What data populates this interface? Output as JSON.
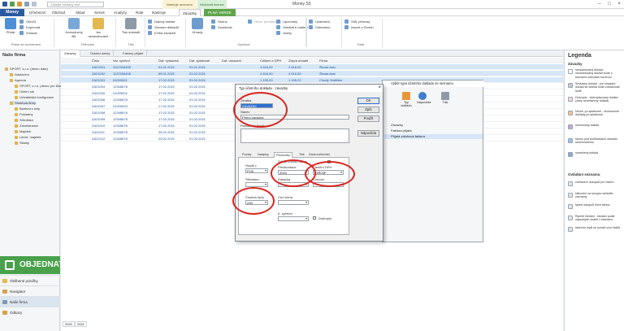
{
  "app": {
    "window_title": "Money S5",
    "search_placeholder": "Zadejte hledaný text",
    "context_tab_1": "Nástroje seznamu",
    "context_tab_2": "Možnosti licence"
  },
  "menu": {
    "brand": "Money",
    "tabs": [
      "Účetnictví",
      "Obchod",
      "Sklad",
      "Servis",
      "Analýzy",
      "Role",
      "Nástroje",
      "Závazky",
      "PLNÁ VERZE"
    ],
    "active_tab": "Závazky"
  },
  "ribbon": {
    "groups": [
      {
        "label": "Práce se seznamem",
        "buttons": [
          "Otevřít",
          "Kopírovat",
          "Smazat",
          "Přidat"
        ]
      },
      {
        "label": "Filtrování",
        "buttons": [
          "Jednoduchý filtr",
          "Jen nezaúčtované"
        ]
      },
      {
        "label": "Tisk",
        "buttons": [
          "Tisk dokladů"
        ]
      },
      {
        "label": "",
        "buttons": [
          "Datový doklad",
          "Seznam dokladů",
          "Kniha závazků"
        ]
      },
      {
        "label": "Operace",
        "buttons": [
          "Úhrady",
          "Storno",
          "Zaúčtovat",
          "Hrom. přeúčtování",
          "Upomínky",
          "Odeslat e-mailem",
          "Vazby"
        ]
      },
      {
        "label": "",
        "buttons": [
          "Uzamčení",
          "Odemčení"
        ]
      },
      {
        "label": "Data",
        "buttons": [
          "XML přenosy",
          "Import z Excelu"
        ]
      }
    ]
  },
  "leftnav": {
    "title": "Naše firma",
    "tree": [
      "SPORT, s.r.o. (demo data)",
      "Nastavení",
      "Agenda",
      "SPORT, s.r.o. (demo pro Money S5)",
      "Účetní rok",
      "Uživatelská konfigurace",
      "Struktura firmy",
      "Bankovní účty",
      "Pokladny",
      "Střediska",
      "Zaměstnanci",
      "Majetek",
      "Likvid. majetek",
      "Sklady"
    ],
    "objednat": "OBJEDNAT",
    "links": [
      "Oblíbené položky",
      "Navigátor",
      "Naše firma",
      "Odkazy"
    ],
    "selected_link": "Naše firma"
  },
  "list": {
    "tabs": [
      "Závazky",
      "Ostatní dávky",
      "Faktury přijaté"
    ],
    "active_tab": "Závazky",
    "columns": [
      "Číslo",
      "Var. symbol",
      "Dat. vystavení",
      "Dat. splatnosti",
      "Dat. uhrazení",
      "Celkem s DPH",
      "Zbývá uhradit",
      "Firma"
    ],
    "rows": [
      [
        "ZA21001",
        "1122334455",
        "01.01.2021",
        "01.01.2021",
        "",
        "4 616,00",
        "4 616,00",
        "Škoda Auto"
      ],
      [
        "ZA21002",
        "1122334455",
        "05.01.2021",
        "01.02.2021",
        "",
        "4 616,00",
        "4 616,00",
        "Škoda Auto"
      ],
      [
        "ZA21003",
        "01009001",
        "17.02.2021",
        "01.02.2021",
        "",
        "1 195,20",
        "1 195,20",
        "Chudý Jindřiška"
      ],
      [
        "ZA21004",
        "12345678",
        "17.02.2021",
        "01.02.2021",
        "",
        "",
        "",
        ""
      ],
      [
        "ZA21005",
        "01009002",
        "17.02.2021",
        "01.02.2021",
        "",
        "",
        "",
        ""
      ],
      [
        "ZA21006",
        "12345678",
        "17.02.2021",
        "01.02.2021",
        "",
        "",
        "",
        ""
      ],
      [
        "ZA21007",
        "01009003",
        "17.02.2021",
        "01.02.2021",
        "",
        "",
        "",
        ""
      ],
      [
        "ZA21008",
        "12345678",
        "17.02.2021",
        "01.02.2021",
        "",
        "",
        "",
        ""
      ],
      [
        "ZA21009",
        "12345678",
        "17.02.2021",
        "01.02.2021",
        "",
        "",
        "",
        ""
      ],
      [
        "ZA21010",
        "12345678",
        "17.02.2021",
        "01.02.2021",
        "",
        "",
        "",
        ""
      ],
      [
        "ZA21011",
        "12345678",
        "25.02.2021",
        "01.02.2021",
        "",
        "",
        "",
        ""
      ],
      [
        "ZA21012",
        "12345678",
        "25.02.2021",
        "01.03.2021",
        "",
        "",
        "",
        ""
      ]
    ],
    "bottom_tabs": [
      "2020",
      "2021"
    ]
  },
  "legend": {
    "title": "Legenda",
    "section_1": "Závazky",
    "items_1": [
      {
        "text": "nezaúčtovaný doklad - nezaúčtovaný doklad bude v seznamu zobrazen kurzívou",
        "color": "#ffffff"
      },
      {
        "text": "Smazaný doklad - pro smazání doklad se doklad bude zobrazovat šedě",
        "color": "#c9c9c9"
      },
      {
        "text": "Dobropis - dobropisovaný doklad (zaný neuhrazený doklad)",
        "color": "#f8d7d7"
      },
      {
        "text": "Neuhr. po splatnosti - neuhrazené doklady po splatnosti",
        "color": "#f3c38f"
      },
      {
        "text": "stornovaný doklad",
        "color": "#c8a6d8"
      },
      {
        "text": "storno pod protidoklad k dokladu stornovanému",
        "color": "#9fc3e8"
      },
      {
        "text": "uzamčený doklad",
        "color": "#8aa9c8"
      }
    ],
    "section_2": "Ovládání seznamu",
    "items_2": [
      {
        "text": "zobrazení dosupců pro řazení",
        "color": "#e1e4e8"
      },
      {
        "text": "kliknutím na sloupec seřadíte záznamy",
        "color": "#e1e4e8"
      },
      {
        "text": "tažení sloupců mezi sebou",
        "color": "#e1e4e8"
      },
      {
        "text": "Rychlé hledání - hledání podle napsaných znaků v záznamu",
        "color": "#e1e4e8"
      },
      {
        "text": "tažením myši se označí více řádků",
        "color": "#e1e4e8"
      }
    ]
  },
  "bg_dialog": {
    "title": "Výběr typu účetního dokladu ze seznamu",
    "tools": [
      "Typ dokladu",
      "Nápověda",
      "Tisk"
    ],
    "rows": [
      "Závazky",
      "Faktura přijatá",
      "Přijatá zálohová faktura"
    ]
  },
  "dialog": {
    "title": "Typ účetního dokladu - závazky",
    "zkratka_label": "Zkratka",
    "zkratka_value": "ZÁVAZEK",
    "nazev_label": "Název",
    "nazev_value": "Přímo závazek",
    "poznamka_label": "Poznámka (text)",
    "buttons": [
      "OK",
      "Zpět",
      "Použít",
      "Nápověda"
    ],
    "tabs": [
      "Popisy",
      "Nadpisy",
      "Předvolby",
      "Tisk",
      "Zaokrouhlování"
    ],
    "active_tab": "Předvolby",
    "hradit_label": "Hradit z",
    "hradit_value": "POK",
    "predkontace_label": "Předkontace",
    "predkontace_value": "2004",
    "clenni_dph_label": "Členění DPH",
    "clenni_dph_value": "19Ř03P",
    "zpusob_ucovani_label": "Způsob účtování faktury",
    "stredisko_label": "Středisko",
    "cinnost_label": "Činnost",
    "zakazka_label": "Zakázka",
    "ciselna_rada_label": "Číselná řada",
    "ciselna_rada_value": "ZAV",
    "col_mena_label": "Cizí měna",
    "k_symbol_label": "K. symbol",
    "dobropis_label": "Dobropis"
  }
}
